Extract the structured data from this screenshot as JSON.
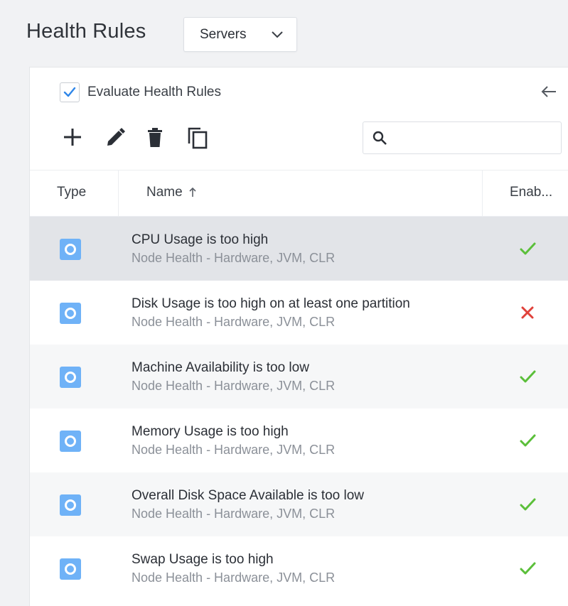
{
  "header": {
    "title": "Health Rules",
    "select_value": "Servers"
  },
  "panel": {
    "evaluate_label": "Evaluate Health Rules",
    "evaluate_checked": true,
    "search_placeholder": ""
  },
  "toolbar": {
    "icons": [
      "add-icon",
      "edit-pencil-icon",
      "delete-trash-icon",
      "copy-icon"
    ]
  },
  "table": {
    "columns": [
      "Type",
      "Name",
      "Enab..."
    ],
    "sort_column": "Name",
    "rows": [
      {
        "title": "CPU Usage is too high",
        "subtitle": "Node Health - Hardware, JVM, CLR",
        "enabled": true
      },
      {
        "title": "Disk Usage is too high on at least one partition",
        "subtitle": "Node Health - Hardware, JVM, CLR",
        "enabled": false
      },
      {
        "title": "Machine Availability is too low",
        "subtitle": "Node Health - Hardware, JVM, CLR",
        "enabled": true
      },
      {
        "title": "Memory Usage is too high",
        "subtitle": "Node Health - Hardware, JVM, CLR",
        "enabled": true
      },
      {
        "title": "Overall Disk Space Available is too low",
        "subtitle": "Node Health - Hardware, JVM, CLR",
        "enabled": true
      },
      {
        "title": "Swap Usage is too high",
        "subtitle": "Node Health - Hardware, JVM, CLR",
        "enabled": true
      }
    ]
  },
  "colors": {
    "check_green": "#5bbf3a",
    "cross_red": "#e0413a",
    "type_icon_blue": "#6fb2f7",
    "selected_row": "#e2e4e8"
  }
}
